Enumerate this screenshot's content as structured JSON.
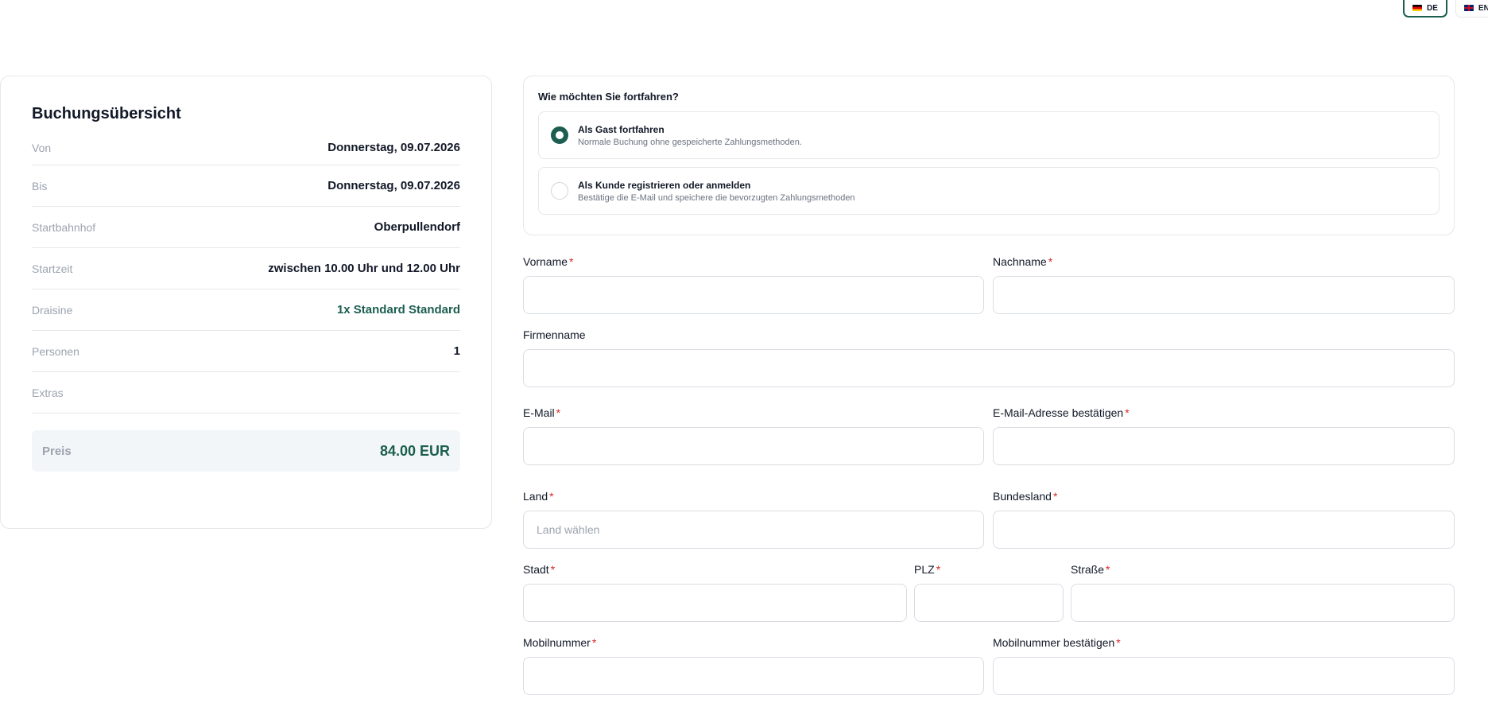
{
  "language_switcher": {
    "items": [
      {
        "label": "DE",
        "active": true
      },
      {
        "label": "EN",
        "active": false
      }
    ]
  },
  "summary": {
    "title": "Buchungsübersicht",
    "rows": [
      {
        "label": "Von",
        "value": "Donnerstag, 09.07.2026"
      },
      {
        "label": "Bis",
        "value": "Donnerstag, 09.07.2026"
      },
      {
        "label": "Startbahnhof",
        "value": "Oberpullendorf"
      },
      {
        "label": "Startzeit",
        "value": "zwischen 10.00 Uhr und 12.00 Uhr"
      },
      {
        "label": "Draisine",
        "value": "1x Standard Standard"
      },
      {
        "label": "Personen",
        "value": "1"
      },
      {
        "label": "Extras",
        "value": ""
      }
    ],
    "price_label": "Preis",
    "price_value": "84.00 EUR"
  },
  "proceed": {
    "question": "Wie möchten Sie fortfahren?",
    "options": [
      {
        "title": "Als Gast fortfahren",
        "description": "Normale Buchung ohne gespeicherte Zahlungsmethoden.",
        "selected": true
      },
      {
        "title": "Als Kunde registrieren oder anmelden",
        "description": "Bestätige die E-Mail und speichere die bevorzugten Zahlungsmethoden",
        "selected": false
      }
    ]
  },
  "form": {
    "first_name": {
      "label": "Vorname",
      "required": "*",
      "value": ""
    },
    "last_name": {
      "label": "Nachname",
      "required": "*",
      "value": ""
    },
    "company": {
      "label": "Firmenname",
      "value": ""
    },
    "email": {
      "label": "E-Mail",
      "required": "*",
      "value": ""
    },
    "email_confirm": {
      "label": "E-Mail-Adresse bestätigen",
      "required": "*",
      "value": ""
    },
    "country": {
      "label": "Land",
      "required": "*",
      "value": "",
      "placeholder": "Land wählen"
    },
    "state": {
      "label": "Bundesland",
      "required": "*",
      "value": ""
    },
    "city": {
      "label": "Stadt",
      "required": "*",
      "value": ""
    },
    "zip": {
      "label": "PLZ",
      "required": "*",
      "value": ""
    },
    "street": {
      "label": "Straße",
      "required": "*",
      "value": ""
    },
    "mobile": {
      "label": "Mobilnummer",
      "required": "*",
      "value": ""
    },
    "mobile_confirm": {
      "label": "Mobilnummer bestätigen",
      "required": "*",
      "value": ""
    }
  },
  "colors": {
    "accent": "#1b5e4f",
    "required": "#dc2626",
    "border": "#e5e7eb"
  }
}
